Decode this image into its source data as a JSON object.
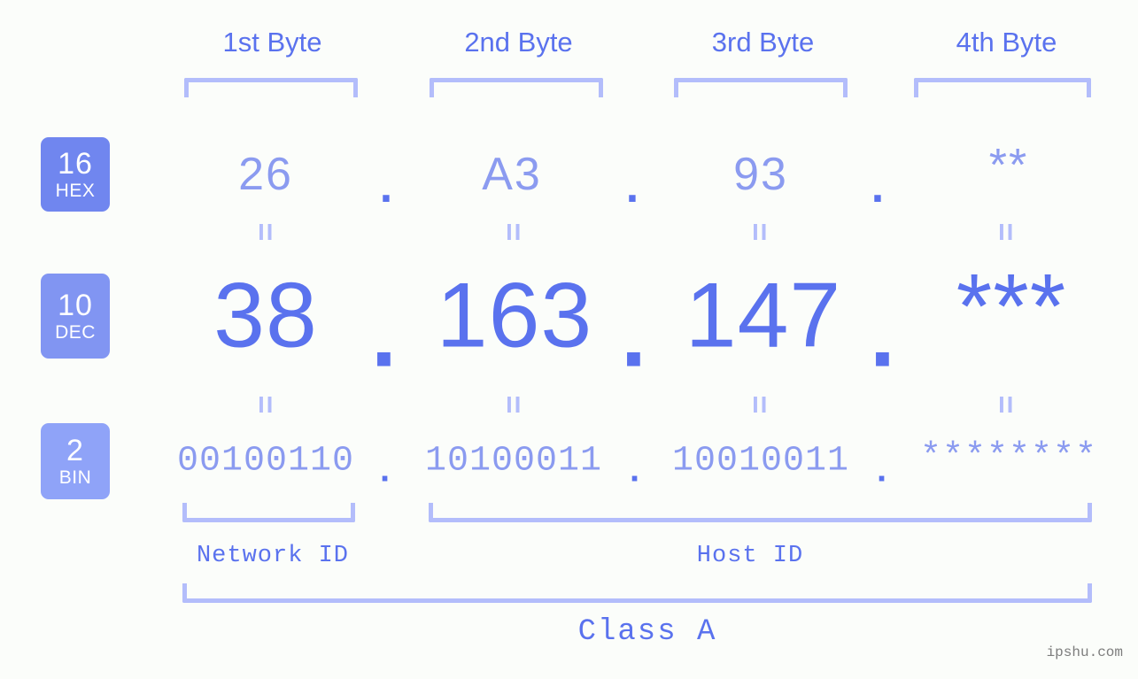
{
  "page": {
    "background_color": "#fbfdfa",
    "accent_color": "#5a72ee",
    "light_accent_color": "#8b9bf0",
    "bracket_color": "#b3bdfb",
    "watermark": "ipshu.com"
  },
  "byte_headers": [
    {
      "label": "1st Byte"
    },
    {
      "label": "2nd Byte"
    },
    {
      "label": "3rd Byte"
    },
    {
      "label": "4th Byte"
    }
  ],
  "rows": {
    "hex": {
      "badge_number": "16",
      "badge_abbr": "HEX",
      "badge_color": "#7086ef",
      "values": [
        "26",
        "A3",
        "93",
        "**"
      ],
      "separator": "."
    },
    "dec": {
      "badge_number": "10",
      "badge_abbr": "DEC",
      "badge_color": "#8195f2",
      "values": [
        "38",
        "163",
        "147",
        "***"
      ],
      "separator": "."
    },
    "bin": {
      "badge_number": "2",
      "badge_abbr": "BIN",
      "badge_color": "#8fa3f8",
      "values": [
        "00100110",
        "10100011",
        "10010011",
        "********"
      ],
      "separator": "."
    }
  },
  "equals": {
    "symbol": "="
  },
  "footer": {
    "network_id_label": "Network ID",
    "host_id_label": "Host ID",
    "class_label": "Class A"
  }
}
